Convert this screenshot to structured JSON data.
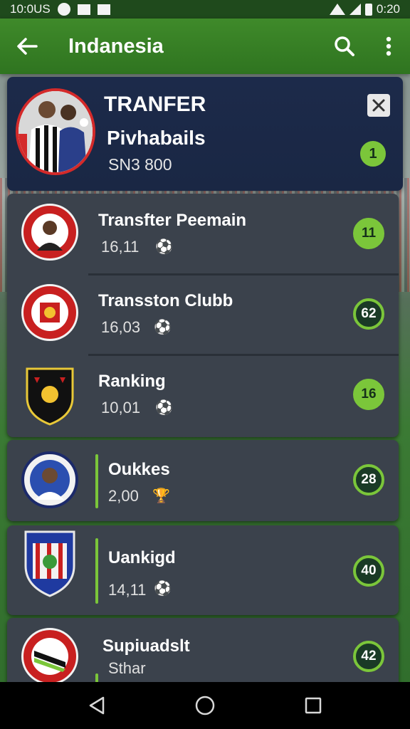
{
  "status_bar": {
    "time_left": "10:0US",
    "time_right": "0:20"
  },
  "app_bar": {
    "title": "Indanesia",
    "icons": [
      "back-arrow-icon",
      "search-icon",
      "more-vert-icon"
    ]
  },
  "header": {
    "title": "TRANFER",
    "subtitle": "Pivhabails",
    "value": "SN3 800",
    "badge": "1"
  },
  "rows": [
    {
      "title": "Transfter Peemain",
      "value": "16,11",
      "badge": "11"
    },
    {
      "title": "Transston Clubb",
      "value": "16,03",
      "badge": "62"
    },
    {
      "title": "Ranking",
      "value": "10,01",
      "badge": "16"
    },
    {
      "title": "Oukkes",
      "value": "2,00",
      "badge": "28"
    },
    {
      "title": "Uankigd",
      "value": "14,11",
      "badge": "40"
    },
    {
      "title": "Supiuadslt",
      "value": "Sthar",
      "badge": "42"
    }
  ],
  "colors": {
    "accent_green": "#7bc63a",
    "app_bar": "#3f8a2a",
    "header_card": "#1c2a4a",
    "list_card": "#3b424c"
  }
}
